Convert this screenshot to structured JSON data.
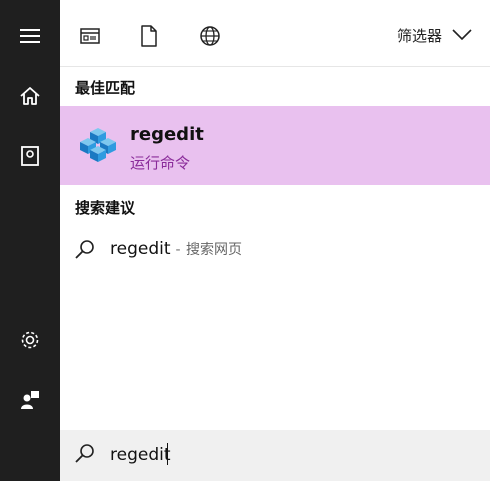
{
  "colors": {
    "rail_bg": "#1f1f1f",
    "highlight_bg": "#e9c1ef",
    "accent_sub": "#8a2b9a",
    "search_bg": "#f0f0f0"
  },
  "rail": {
    "icons": [
      "hamburger-menu-icon",
      "home-icon",
      "notebook-icon",
      "settings-icon",
      "feedback-icon"
    ]
  },
  "topbar": {
    "icons": [
      "apps-view-icon",
      "documents-icon",
      "web-globe-icon"
    ],
    "filter_label": "筛选器"
  },
  "best_match": {
    "heading": "最佳匹配",
    "title": "regedit",
    "subtitle": "运行命令",
    "icon": "registry-editor-icon"
  },
  "suggestions": {
    "heading": "搜索建议",
    "items": [
      {
        "term": "regedit",
        "separator": "-",
        "suffix": "搜索网页"
      }
    ]
  },
  "search": {
    "value": "regedit"
  }
}
